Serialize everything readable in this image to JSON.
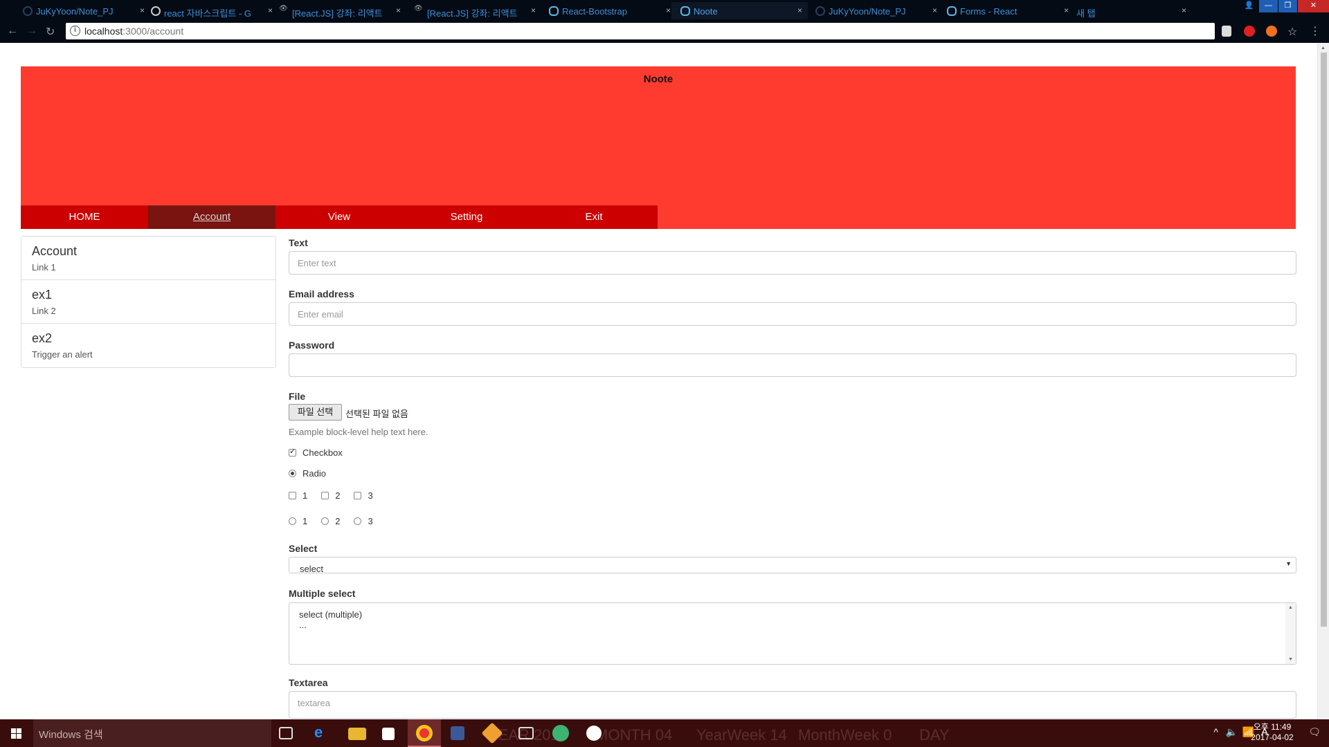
{
  "browser": {
    "tabs": [
      {
        "title": "JuKyYoon/Note_PJ",
        "icon": "github-icon"
      },
      {
        "title": "react 자바스크립트 - G",
        "icon": "google-icon"
      },
      {
        "title": "[React.JS] 강좌: 리액트",
        "icon": "eye-icon"
      },
      {
        "title": "[React.JS] 강좌: 리액트",
        "icon": "eye-icon"
      },
      {
        "title": "React-Bootstrap",
        "icon": "react-icon"
      },
      {
        "title": "Noote",
        "icon": "react-icon"
      },
      {
        "title": "JuKyYoon/Note_PJ",
        "icon": "github-icon"
      },
      {
        "title": "Forms - React",
        "icon": "react-icon"
      },
      {
        "title": "새 탭",
        "icon": "blank-icon"
      }
    ],
    "active_tab_index": 5,
    "close_glyph": "×",
    "url_host": "localhost",
    "url_path": ":3000/account"
  },
  "header": {
    "brand": "Noote",
    "menu": [
      "HOME",
      "Account",
      "View",
      "Setting",
      "Exit"
    ],
    "active_menu": "Account",
    "color": "#ff3b30",
    "menu_color": "#cc0000"
  },
  "sidebar": [
    {
      "heading": "Account",
      "text": "Link 1"
    },
    {
      "heading": "ex1",
      "text": "Link 2"
    },
    {
      "heading": "ex2",
      "text": "Trigger an alert"
    }
  ],
  "form": {
    "text_label": "Text",
    "text_placeholder": "Enter text",
    "email_label": "Email address",
    "email_placeholder": "Enter email",
    "password_label": "Password",
    "file_label": "File",
    "file_button": "파일 선택",
    "file_status": "선택된 파일 없음",
    "help_text": "Example block-level help text here.",
    "checkbox_label": "Checkbox",
    "radio_label": "Radio",
    "inline_checkboxes": [
      "1",
      "2",
      "3"
    ],
    "inline_radios": [
      "1",
      "2",
      "3"
    ],
    "select_label": "Select",
    "select_value": "select",
    "multiselect_label": "Multiple select",
    "multiselect_options": [
      "select (multiple)",
      "..."
    ],
    "textarea_label": "Textarea",
    "textarea_placeholder": "textarea"
  },
  "taskbar": {
    "search": "Windows 검색",
    "labels": [
      "YEAR 2017",
      "MONTH 04",
      "YearWeek 14",
      "MonthWeek 0",
      "DAY"
    ],
    "time": "오후 11:49",
    "date": "2017-04-02",
    "ime": "A"
  }
}
